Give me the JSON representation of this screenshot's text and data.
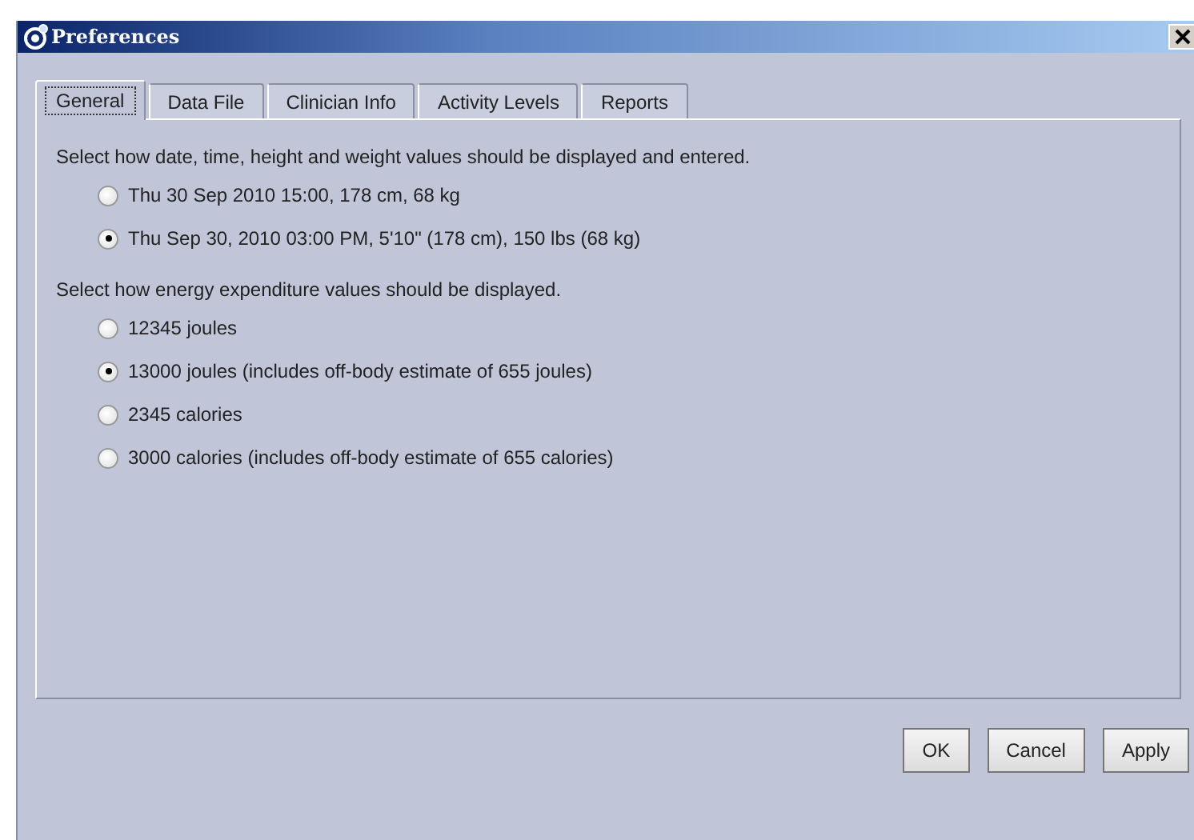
{
  "window": {
    "title": "Preferences"
  },
  "tabs": [
    {
      "label": "General",
      "selected": true
    },
    {
      "label": "Data File",
      "selected": false
    },
    {
      "label": "Clinician Info",
      "selected": false
    },
    {
      "label": "Activity Levels",
      "selected": false
    },
    {
      "label": "Reports",
      "selected": false
    }
  ],
  "sections": [
    {
      "label": "Select how date, time, height and weight values should be displayed and entered.",
      "options": [
        {
          "label": "Thu 30 Sep 2010 15:00, 178 cm, 68 kg",
          "selected": false
        },
        {
          "label": "Thu Sep 30, 2010 03:00 PM, 5'10\" (178 cm), 150 lbs (68 kg)",
          "selected": true
        }
      ]
    },
    {
      "label": "Select how energy expenditure values should be displayed.",
      "options": [
        {
          "label": "12345 joules",
          "selected": false
        },
        {
          "label": "13000 joules (includes off-body estimate of 655 joules)",
          "selected": true
        },
        {
          "label": "2345 calories",
          "selected": false
        },
        {
          "label": "3000 calories (includes off-body estimate of 655 calories)",
          "selected": false
        }
      ]
    }
  ],
  "buttons": [
    "OK",
    "Cancel",
    "Apply"
  ]
}
